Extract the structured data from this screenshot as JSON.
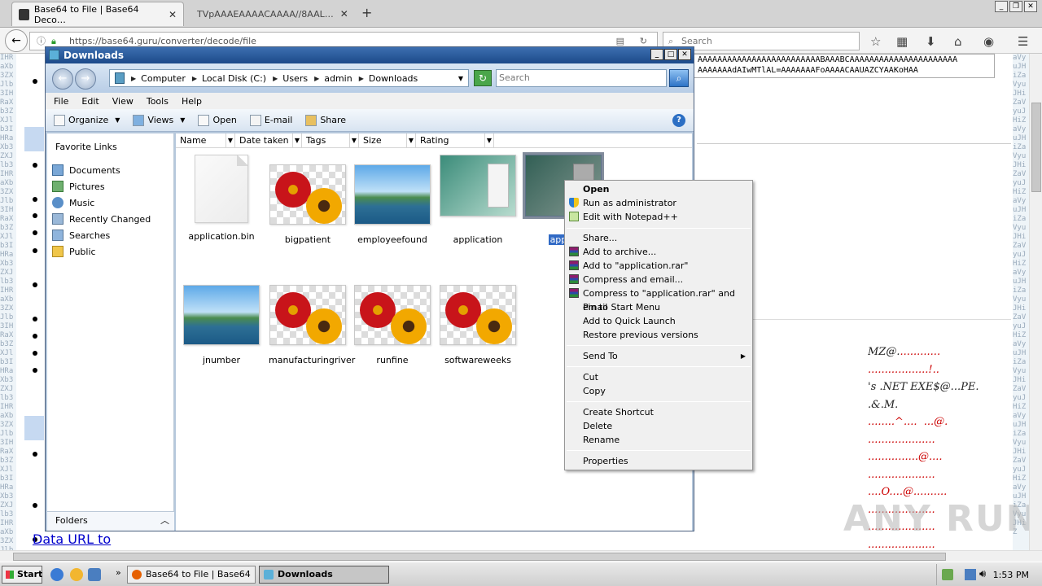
{
  "browser": {
    "tabs": [
      {
        "title": "Base64 to File | Base64 Deco…",
        "active": true
      },
      {
        "title": "TVpAAAEAAAACAAAA//8AAL…",
        "active": false
      }
    ],
    "url": "https://base64.guru/converter/decode/file",
    "search_placeholder": "Search"
  },
  "page": {
    "textarea_lines": [
      "AAAAAAAAAAAAAAAAAAAAAAAAABAAABCAAAAAAAAAAAAAAAAAAAAAA",
      "AAAAAAAdAIwMTlAL=AAAAAAAFoAAAACAAUAZCYAAKoHAA"
    ],
    "hex_dump": [
      {
        "text": "MZ@.",
        "dots": "............"
      },
      {
        "text": "",
        "dots": "..................!.."
      },
      {
        "text": "'s .NET EXE$@...PE.",
        "dots": ""
      },
      {
        "text": ".&.M.",
        "dots": ""
      },
      {
        "text": "",
        "dots": "........^....  ...@."
      },
      {
        "text": "",
        "dots": "...................."
      },
      {
        "text": "",
        "dots": "...............@...."
      },
      {
        "text": "",
        "dots": "...................."
      },
      {
        "text": "",
        "dots": "....O....@.........."
      },
      {
        "text": "",
        "dots": "...................."
      },
      {
        "text": "",
        "dots": "...................."
      },
      {
        "text": "",
        "dots": "...................."
      }
    ],
    "data_url_link": "Data URL to",
    "watermark": "ANY RUN"
  },
  "explorer": {
    "title": "Downloads",
    "breadcrumb": [
      "Computer",
      "Local Disk (C:)",
      "Users",
      "admin",
      "Downloads"
    ],
    "search_placeholder": "Search",
    "menu": [
      "File",
      "Edit",
      "View",
      "Tools",
      "Help"
    ],
    "toolbar": [
      "Organize",
      "Views",
      "Open",
      "E-mail",
      "Share"
    ],
    "favorites_title": "Favorite Links",
    "favorites": [
      "Documents",
      "Pictures",
      "Music",
      "Recently Changed",
      "Searches",
      "Public"
    ],
    "folders_label": "Folders",
    "columns": [
      "Name",
      "Date taken",
      "Tags",
      "Size",
      "Rating"
    ],
    "files": [
      {
        "name": "application.bin",
        "thumb": "blank"
      },
      {
        "name": "bigpatient",
        "thumb": "flower"
      },
      {
        "name": "employeefound",
        "thumb": "landscape"
      },
      {
        "name": "application",
        "thumb": "doc"
      },
      {
        "name": "applic",
        "thumb": "doc",
        "selected": true
      },
      {
        "name": "jnumber",
        "thumb": "landscape"
      },
      {
        "name": "manufacturingriver",
        "thumb": "flower"
      },
      {
        "name": "runfine",
        "thumb": "flower"
      },
      {
        "name": "softwareweeks",
        "thumb": "flower"
      }
    ]
  },
  "context_menu": {
    "open": "Open",
    "run_as_admin": "Run as administrator",
    "edit_npp": "Edit with Notepad++",
    "share": "Share...",
    "add_archive": "Add to archive...",
    "add_rar": "Add to \"application.rar\"",
    "compress_email": "Compress and email...",
    "compress_rar_email": "Compress to \"application.rar\" and email",
    "pin_start": "Pin to Start Menu",
    "add_quick": "Add to Quick Launch",
    "restore": "Restore previous versions",
    "send_to": "Send To",
    "cut": "Cut",
    "copy": "Copy",
    "create_shortcut": "Create Shortcut",
    "delete": "Delete",
    "rename": "Rename",
    "properties": "Properties"
  },
  "taskbar": {
    "start": "Start",
    "tasks": [
      {
        "title": "Base64 to File | Base64 ...",
        "active": false
      },
      {
        "title": "Downloads",
        "active": true
      }
    ],
    "clock": "1:53 PM"
  }
}
